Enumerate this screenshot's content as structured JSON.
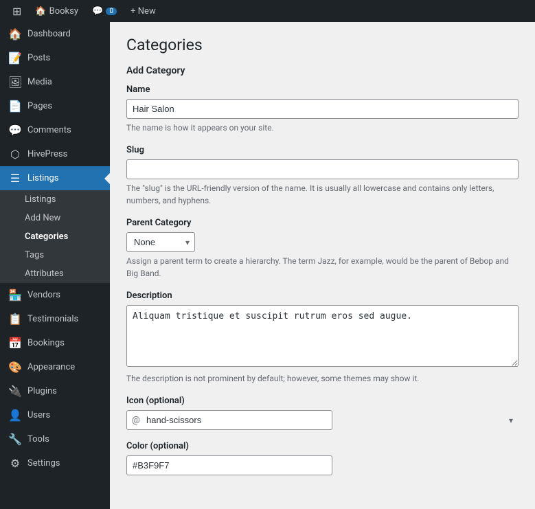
{
  "topbar": {
    "wp_icon": "⊞",
    "site_name": "Booksy",
    "comments_icon": "💬",
    "comments_count": "0",
    "new_label": "+ New"
  },
  "sidebar": {
    "items": [
      {
        "id": "dashboard",
        "icon": "🏠",
        "label": "Dashboard"
      },
      {
        "id": "posts",
        "icon": "📝",
        "label": "Posts"
      },
      {
        "id": "media",
        "icon": "🖼",
        "label": "Media"
      },
      {
        "id": "pages",
        "icon": "📄",
        "label": "Pages"
      },
      {
        "id": "comments",
        "icon": "💬",
        "label": "Comments"
      },
      {
        "id": "hivepress",
        "icon": "⬡",
        "label": "HivePress"
      },
      {
        "id": "listings",
        "icon": "☰",
        "label": "Listings",
        "active": true
      },
      {
        "id": "vendors",
        "icon": "🏪",
        "label": "Vendors"
      },
      {
        "id": "testimonials",
        "icon": "📋",
        "label": "Testimonials"
      },
      {
        "id": "bookings",
        "icon": "📅",
        "label": "Bookings"
      },
      {
        "id": "appearance",
        "icon": "🎨",
        "label": "Appearance"
      },
      {
        "id": "plugins",
        "icon": "🔌",
        "label": "Plugins"
      },
      {
        "id": "users",
        "icon": "👤",
        "label": "Users"
      },
      {
        "id": "tools",
        "icon": "🔧",
        "label": "Tools"
      },
      {
        "id": "settings",
        "icon": "⚙",
        "label": "Settings"
      }
    ],
    "submenu": [
      {
        "id": "listings-sub",
        "label": "Listings"
      },
      {
        "id": "add-new-sub",
        "label": "Add New"
      },
      {
        "id": "categories-sub",
        "label": "Categories",
        "active": true
      },
      {
        "id": "tags-sub",
        "label": "Tags"
      },
      {
        "id": "attributes-sub",
        "label": "Attributes"
      }
    ]
  },
  "page": {
    "title": "Categories",
    "add_category_title": "Add Category",
    "fields": {
      "name": {
        "label": "Name",
        "value": "Hair Salon",
        "placeholder": ""
      },
      "slug": {
        "label": "Slug",
        "value": "",
        "placeholder": "",
        "hint": "The \"slug\" is the URL-friendly version of the name. It is usually all lowercase and contains only letters, numbers, and hyphens."
      },
      "name_hint": "The name is how it appears on your site.",
      "parent_category": {
        "label": "Parent Category",
        "value": "None",
        "options": [
          "None"
        ],
        "hint": "Assign a parent term to create a hierarchy. The term Jazz, for example, would be the parent of Bebop and Big Band."
      },
      "description": {
        "label": "Description",
        "value": "Aliquam tristique et suscipit rutrum eros sed augue.",
        "hint": "The description is not prominent by default; however, some themes may show it."
      },
      "icon": {
        "label": "Icon (optional)",
        "prefix": "@",
        "value": "hand-scissors"
      },
      "color": {
        "label": "Color (optional)",
        "value": "#B3F9F7"
      }
    }
  }
}
